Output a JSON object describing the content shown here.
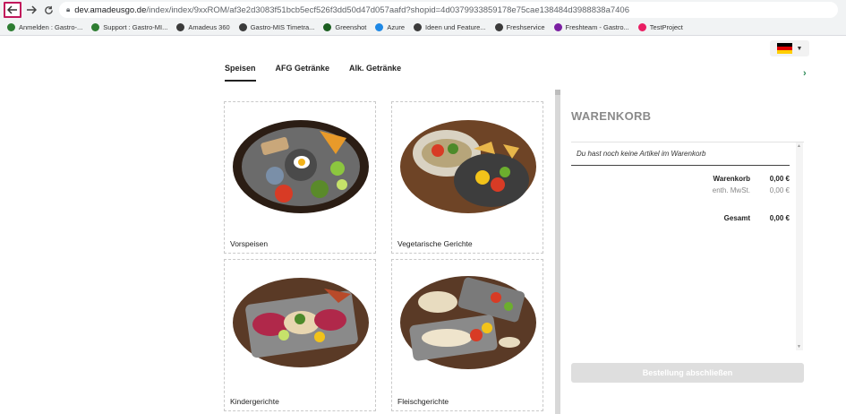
{
  "browser": {
    "url_host": "dev.amadeusgo.de",
    "url_path": "/index/index/9xxROM/af3e2d3083f51bcb5ecf526f3dd50d47d057aafd?shopid=4d0379933859178e75cae138484d3988838a7406",
    "icons": {
      "back": "back-arrow-icon",
      "forward": "forward-arrow-icon",
      "reload": "reload-icon",
      "lock": "lock-icon"
    },
    "bookmarks": [
      {
        "label": "Anmelden : Gastro-...",
        "color": "#2e7d32"
      },
      {
        "label": "Support : Gastro-MI...",
        "color": "#2e7d32"
      },
      {
        "label": "Amadeus 360",
        "color": "#3b3b3b"
      },
      {
        "label": "Gastro-MIS Timetra...",
        "color": "#3b3b3b"
      },
      {
        "label": "Greenshot",
        "color": "#1b5e20"
      },
      {
        "label": "Azure",
        "color": "#1e88e5"
      },
      {
        "label": "Ideen und Feature...",
        "color": "#3b3b3b"
      },
      {
        "label": "Freshservice",
        "color": "#3b3b3b"
      },
      {
        "label": "Freshteam - Gastro...",
        "color": "#7b1fa2"
      },
      {
        "label": "TestProject",
        "color": "#e91e63"
      }
    ]
  },
  "language": {
    "flag": "german-flag-icon",
    "colors": [
      "#000000",
      "#dd0000",
      "#ffce00"
    ]
  },
  "tabs": [
    {
      "label": "Speisen",
      "active": true
    },
    {
      "label": "AFG Getränke",
      "active": false
    },
    {
      "label": "Alk. Getränke",
      "active": false
    }
  ],
  "categories": [
    {
      "title": "Vorspeisen"
    },
    {
      "title": "Vegetarische Gerichte"
    },
    {
      "title": "Kindergerichte"
    },
    {
      "title": "Fleischgerichte"
    }
  ],
  "cart": {
    "title": "WARENKORB",
    "empty_message": "Du hast noch keine Artikel im Warenkorb",
    "rows": [
      {
        "label": "Warenkorb",
        "value": "0,00 €"
      },
      {
        "label": "enth. MwSt.",
        "value": "0,00 €"
      },
      {
        "label": "Gesamt",
        "value": "0,00 €"
      }
    ],
    "order_button": "Bestellung abschließen"
  },
  "colors": {
    "accent_back_highlight": "#c2185b",
    "next_arrow": "#2e8b57"
  }
}
